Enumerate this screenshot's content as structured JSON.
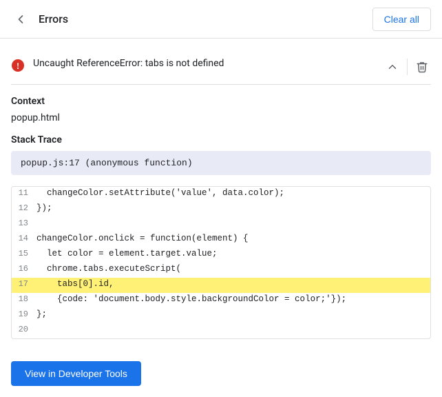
{
  "header": {
    "back_label": "←",
    "title": "Errors",
    "clear_all_label": "Clear all"
  },
  "error": {
    "message": "Uncaught ReferenceError: tabs is not defined"
  },
  "context": {
    "section_title": "Context",
    "file_name": "popup.html"
  },
  "stack_trace": {
    "section_title": "Stack Trace",
    "entry": "popup.js:17 (anonymous function)"
  },
  "code": {
    "lines": [
      {
        "num": "11",
        "code": "  changeColor.setAttribute('value', data.color);",
        "highlighted": false
      },
      {
        "num": "12",
        "code": "});",
        "highlighted": false
      },
      {
        "num": "13",
        "code": "",
        "highlighted": false
      },
      {
        "num": "14",
        "code": "changeColor.onclick = function(element) {",
        "highlighted": false
      },
      {
        "num": "15",
        "code": "  let color = element.target.value;",
        "highlighted": false
      },
      {
        "num": "16",
        "code": "  chrome.tabs.executeScript(",
        "highlighted": false
      },
      {
        "num": "17",
        "code": "    tabs[0].id,",
        "highlighted": true
      },
      {
        "num": "18",
        "code": "    {code: 'document.body.style.backgroundColor = color;'});",
        "highlighted": false
      },
      {
        "num": "19",
        "code": "};",
        "highlighted": false
      },
      {
        "num": "20",
        "code": "",
        "highlighted": false
      }
    ]
  },
  "footer": {
    "dev_tools_label": "View in Developer Tools"
  }
}
